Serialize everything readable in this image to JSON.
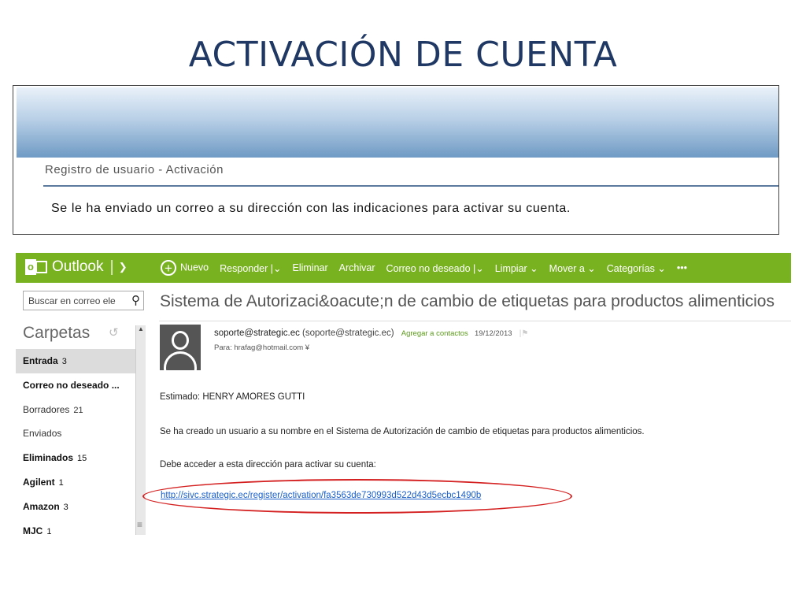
{
  "slide": {
    "title": "ACTIVACIÓN DE CUENTA"
  },
  "registration": {
    "heading": "Registro de usuario - Activación",
    "message": "Se le ha enviado un correo a su dirección con las indicaciones para activar su cuenta."
  },
  "outlook": {
    "brand": "Outlook",
    "commands": [
      "Nuevo",
      "Responder |⌄",
      "Eliminar",
      "Archivar",
      "Correo no deseado |⌄",
      "Limpiar ⌄",
      "Mover a ⌄",
      "Categorías ⌄",
      "•••"
    ],
    "search_placeholder": "Buscar en correo ele",
    "folders_title": "Carpetas",
    "folders": [
      {
        "name": "Entrada",
        "count": "3"
      },
      {
        "name": "Correo no deseado ...",
        "count": ""
      },
      {
        "name": "Borradores",
        "count": "21"
      },
      {
        "name": "Enviados",
        "count": ""
      },
      {
        "name": "Eliminados",
        "count": "15"
      },
      {
        "name": "Agilent",
        "count": "1"
      },
      {
        "name": "Amazon",
        "count": "3"
      },
      {
        "name": "MJC",
        "count": "1"
      }
    ],
    "message": {
      "subject": "Sistema de Autorizaci&oacute;n de cambio de etiquetas para productos alimenticios",
      "sender_name": "soporte@strategic.ec",
      "sender_address": "(soporte@strategic.ec)",
      "add_contact": "Agregar a contactos",
      "date": "19/12/2013",
      "to": "Para: hrafag@hotmail.com ¥",
      "greeting": "Estimado: HENRY AMORES GUTTI",
      "line1": "Se ha creado un usuario a su nombre en el Sistema de Autorización de cambio de etiquetas para productos alimenticios.",
      "line2": "Debe acceder a esta dirección para activar su cuenta:",
      "link": "http://sivc.strategic.ec/register/activation/fa3563de730993d522d43d5ecbc1490b"
    }
  }
}
